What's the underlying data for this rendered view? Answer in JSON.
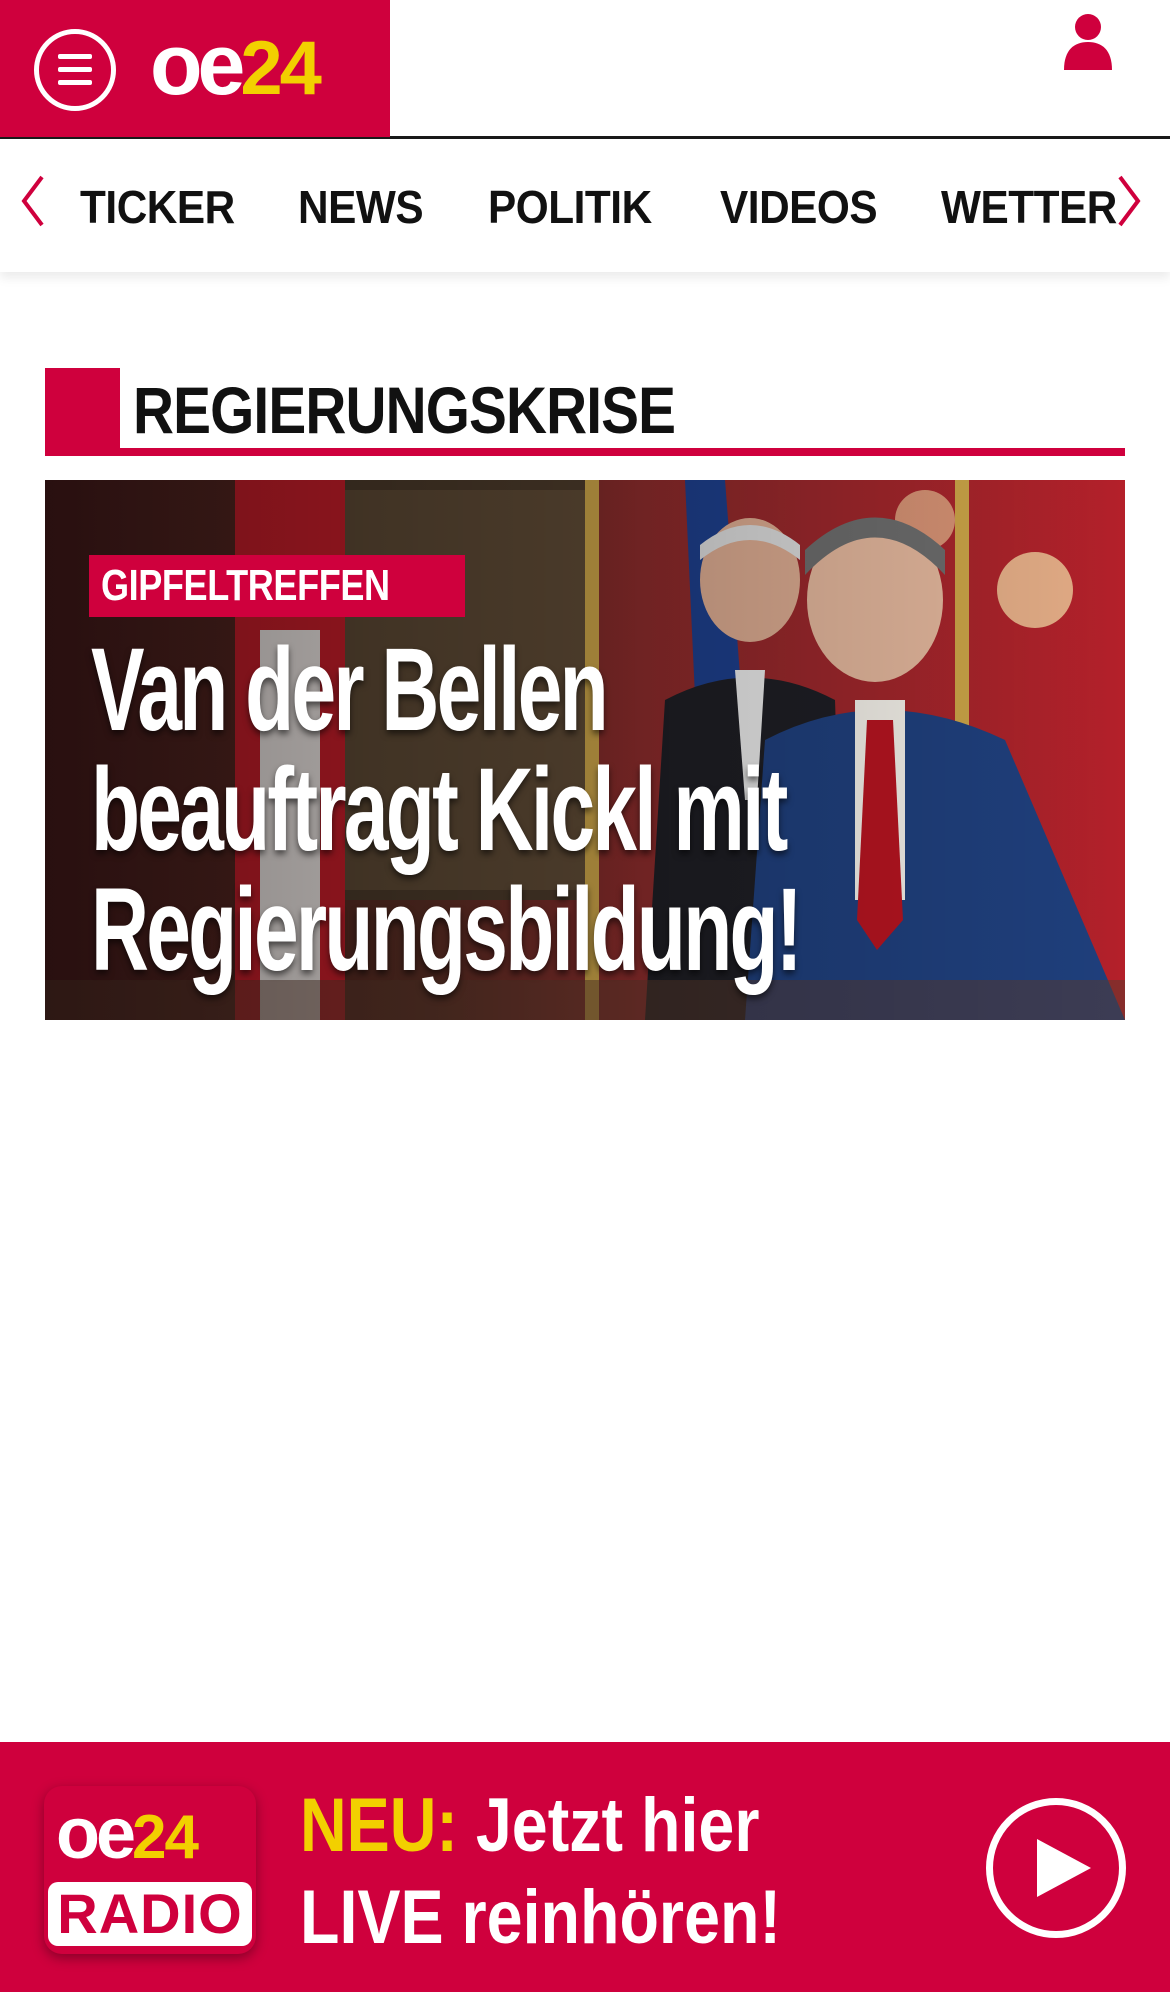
{
  "header": {
    "menu_icon": "hamburger-menu-icon",
    "logo": {
      "part1": "oe",
      "part2": "24"
    },
    "user_icon": "user-icon"
  },
  "nav": {
    "items": [
      {
        "label": "TICKER"
      },
      {
        "label": "NEWS"
      },
      {
        "label": "POLITIK"
      },
      {
        "label": "VIDEOS"
      },
      {
        "label": "WETTER"
      }
    ],
    "prev_icon": "chevron-left-icon",
    "next_icon": "chevron-right-icon"
  },
  "section": {
    "title": "REGIERUNGSKRISE"
  },
  "teaser": {
    "kicker": "GIPFELTREFFEN",
    "headline_lines": [
      "Van der Bellen",
      "beauftragt Kickl mit",
      "Regierungsbildung!"
    ]
  },
  "radio_banner": {
    "logo": {
      "part1": "oe",
      "part2": "24",
      "word": "RADIO"
    },
    "neu": "NEU:",
    "line1_rest": " Jetzt hier",
    "line2": "LIVE reinhören!",
    "play_icon": "play-icon"
  },
  "colors": {
    "brand_red": "#cf003d",
    "logo_yellow": "#f2d000",
    "text_dark": "#111111"
  }
}
